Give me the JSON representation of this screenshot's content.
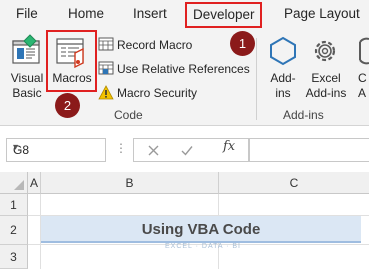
{
  "ribbon": {
    "tabs": [
      {
        "label": "File"
      },
      {
        "label": "Home"
      },
      {
        "label": "Insert"
      },
      {
        "label": "Developer"
      },
      {
        "label": "Page Layout"
      }
    ],
    "code_group": {
      "visual_basic_label": "Visual\nBasic",
      "macros_label": "Macros",
      "record_macro_label": "Record Macro",
      "use_relative_label": "Use Relative References",
      "macro_security_label": "Macro Security",
      "group_label": "Code"
    },
    "addins_group": {
      "addins_label": "Add-\nins",
      "excel_addins_label": "Excel\nAdd-ins",
      "com_label": "C\nA",
      "group_label": "Add-ins"
    },
    "callouts": [
      "1",
      "2"
    ]
  },
  "formula_bar": {
    "name_box_value": "G8",
    "fx_label": "fx",
    "formula_value": ""
  },
  "sheet": {
    "columns": [
      "A",
      "B",
      "C"
    ],
    "rows": [
      "1",
      "2",
      "3"
    ],
    "title_cell_text": "Using VBA Code",
    "watermark": "EXCEL · DATA · BI"
  },
  "colors": {
    "highlight": "#e02020",
    "badge": "#8b1a1a",
    "title_fill": "#dbe7f4"
  }
}
